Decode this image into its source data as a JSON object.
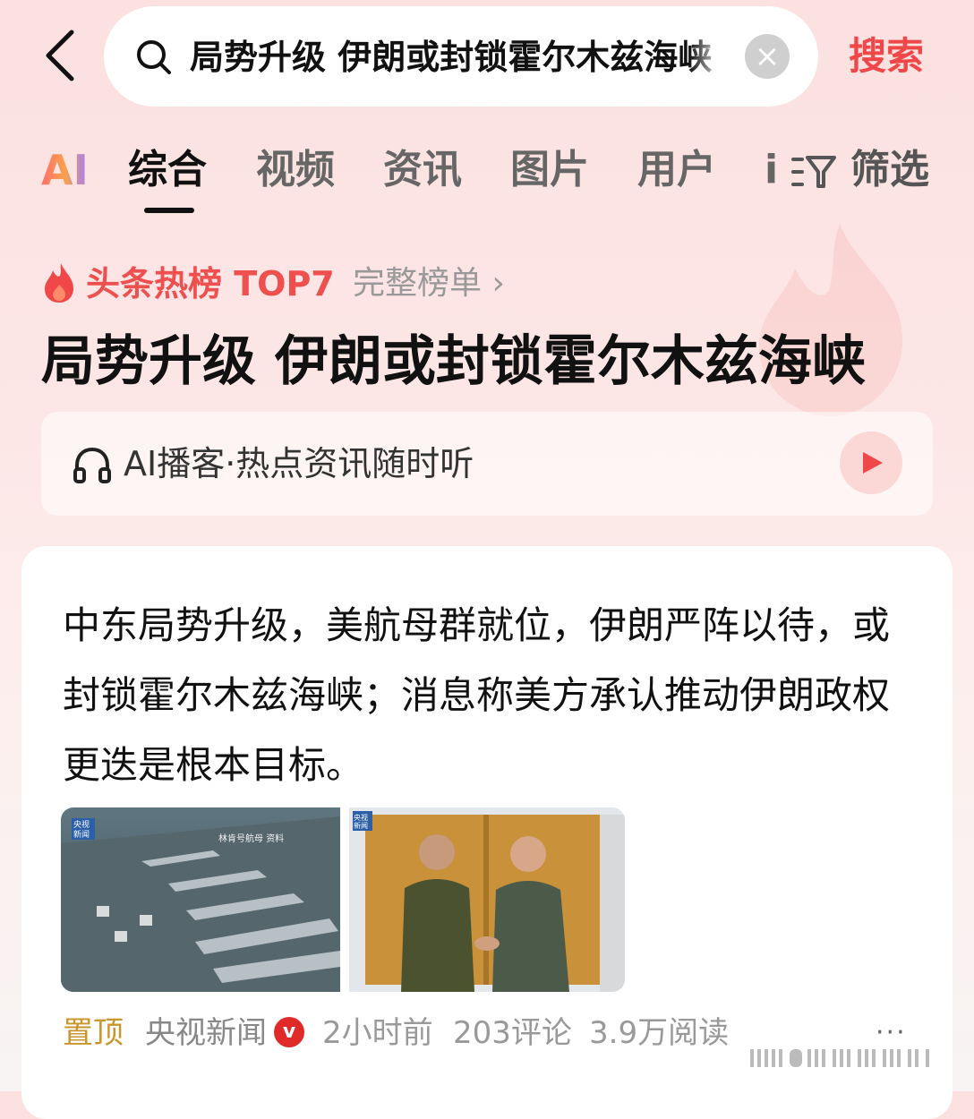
{
  "search": {
    "query": "局势升级 伊朗或封锁霍尔木兹海峡",
    "submit_label": "搜索",
    "clear_symbol": "×"
  },
  "tabs": [
    {
      "label": "AI",
      "active": false
    },
    {
      "label": "综合",
      "active": true
    },
    {
      "label": "视频",
      "active": false
    },
    {
      "label": "资讯",
      "active": false
    },
    {
      "label": "图片",
      "active": false
    },
    {
      "label": "用户",
      "active": false
    },
    {
      "label": "i",
      "active": false
    }
  ],
  "filter": {
    "label": "筛选",
    "icon": "filter-icon"
  },
  "hot": {
    "label": "头条热榜 TOP7",
    "link": "完整榜单 ›"
  },
  "headline": "局势升级 伊朗或封锁霍尔木兹海峡",
  "podcast": {
    "text": "AI播客·热点资讯随时听",
    "icon": "headphones-icon"
  },
  "article": {
    "summary": "中东局势升级，美航母群就位，伊朗严阵以待，或封锁霍尔木兹海峡；消息称美方承认推动伊朗政权更迭是根本目标。",
    "image1_badge": "央视\n新闻",
    "image1_caption": "林肯号航母 资料",
    "image2_badge": "央视\n新闻",
    "pin": "置顶",
    "source": "央视新闻",
    "verified": "v",
    "time": "2小时前",
    "comments": "203评论",
    "reads": "3.9万阅读",
    "more": "···"
  },
  "colors": {
    "accent": "#f04848",
    "hot": "#ee4f4f",
    "pin": "#c9962b"
  }
}
